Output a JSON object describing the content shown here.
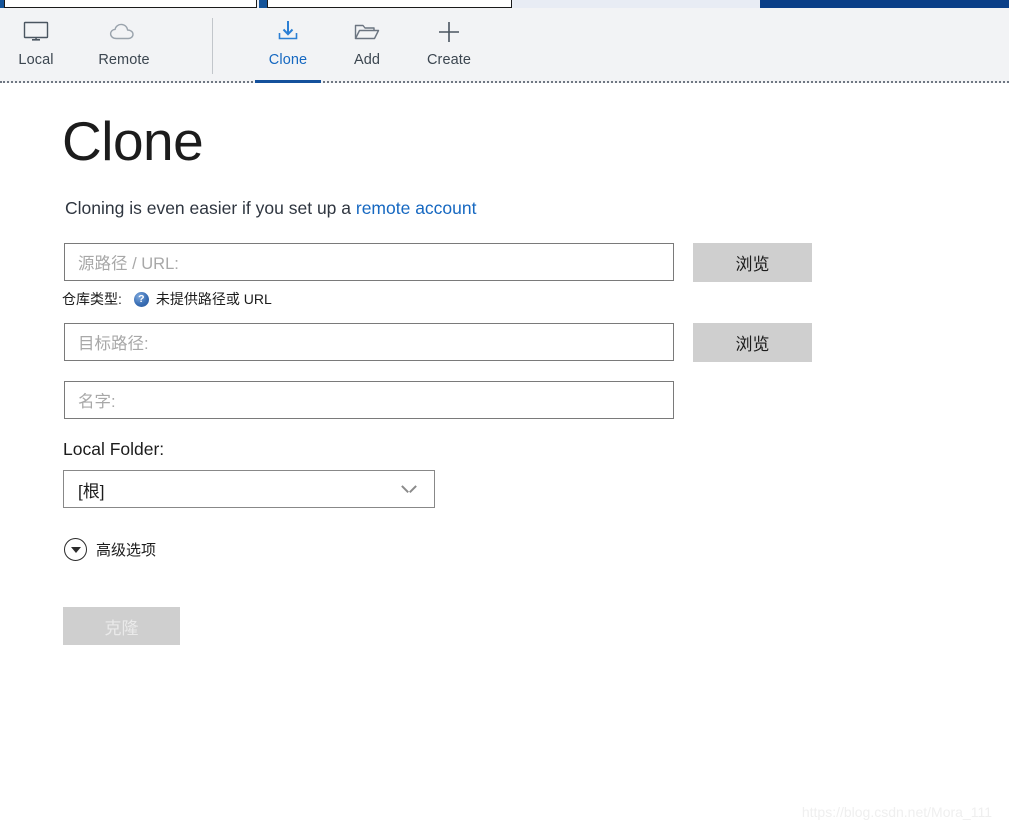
{
  "tabstrip": {
    "tabs": [
      {
        "name": "tab-1",
        "state": "inactive"
      },
      {
        "name": "tab-2",
        "state": "inactive"
      },
      {
        "name": "tab-3",
        "state": "inactive"
      },
      {
        "name": "tab-4",
        "state": "active"
      }
    ]
  },
  "toolbar": {
    "items": [
      {
        "id": "local",
        "label": "Local",
        "icon": "monitor-icon",
        "active": false
      },
      {
        "id": "remote",
        "label": "Remote",
        "icon": "cloud-icon",
        "active": false
      },
      {
        "id": "clone",
        "label": "Clone",
        "icon": "clone-download-icon",
        "active": true
      },
      {
        "id": "add",
        "label": "Add",
        "icon": "folder-icon",
        "active": false
      },
      {
        "id": "create",
        "label": "Create",
        "icon": "plus-icon",
        "active": false
      }
    ]
  },
  "main": {
    "title": "Clone",
    "subtitle_prefix": "Cloning is even easier if you set up a ",
    "subtitle_link": "remote account",
    "source": {
      "placeholder": "源路径 / URL:",
      "value": "",
      "browse_label": "浏览"
    },
    "repo_type": {
      "label": "仓库类型:",
      "help_icon": "help-question-icon",
      "status": "未提供路径或 URL"
    },
    "target": {
      "placeholder": "目标路径:",
      "value": "",
      "browse_label": "浏览"
    },
    "name": {
      "placeholder": "名字:",
      "value": ""
    },
    "local_folder": {
      "label": "Local Folder:",
      "selected": "[根]",
      "chevron_icon": "chevron-down-icon"
    },
    "advanced": {
      "label": "高级选项",
      "icon": "chevron-down-circle-icon"
    },
    "clone_button": {
      "label": "克隆",
      "disabled": true
    }
  },
  "watermark": {
    "text": "https://blog.csdn.net/Mora_111"
  },
  "colors": {
    "accent_blue": "#1668c1",
    "tab_active_blue": "#0f4fa8",
    "toolbar_bg": "#f2f3f5",
    "disabled_button": "#cfcfcf"
  }
}
